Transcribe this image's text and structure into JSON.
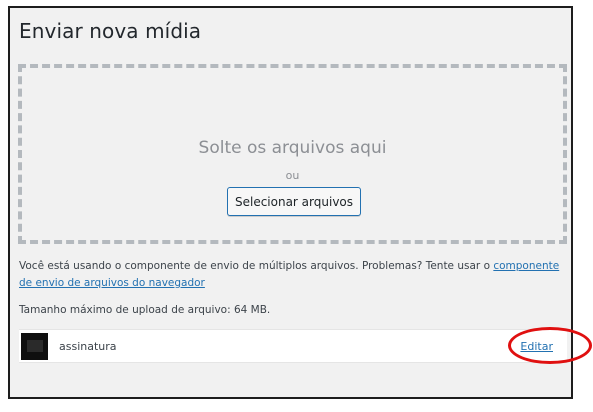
{
  "page": {
    "title": "Enviar nova mídia"
  },
  "uploader": {
    "drop_text": "Solte os arquivos aqui",
    "or_text": "ou",
    "select_button_label": "Selecionar arquivos"
  },
  "info": {
    "multi_uploader_text": "Você está usando o componente de envio de múltiplos arquivos. Problemas? Tente usar o ",
    "browser_uploader_link": "componente de envio de arquivos do navegador",
    "max_upload_size": "Tamanho máximo de upload de arquivo: 64 MB."
  },
  "media_items": [
    {
      "filename": "assinatura",
      "edit_label": "Editar"
    }
  ],
  "colors": {
    "link": "#2271b1",
    "highlight_annotation": "#e01010",
    "background": "#f1f1f1"
  }
}
